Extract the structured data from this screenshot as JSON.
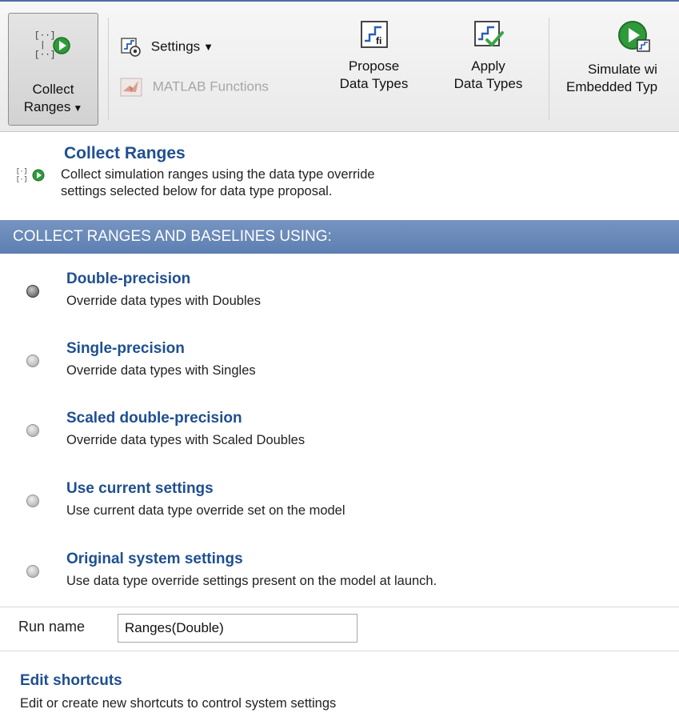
{
  "toolstrip": {
    "collect_ranges": {
      "label_line1": "Collect",
      "label_line2": "Ranges",
      "caret": "▼",
      "icon": "collect-ranges-icon"
    },
    "settings": {
      "label": "Settings",
      "caret": "▼",
      "icon": "settings-icon"
    },
    "matlab_functions": {
      "label": "MATLAB Functions",
      "icon": "matlab-logo-icon"
    },
    "propose": {
      "label_line1": "Propose",
      "label_line2": "Data Types",
      "icon": "propose-fi-icon"
    },
    "apply": {
      "label_line1": "Apply",
      "label_line2": "Data Types",
      "icon": "apply-check-icon"
    },
    "simulate": {
      "label_line1": "Simulate wi",
      "label_line2": "Embedded Typ",
      "icon": "simulate-play-icon"
    }
  },
  "header": {
    "title": "Collect Ranges",
    "description_line1": "Collect simulation ranges using the data type override",
    "description_line2": "settings selected below for data type proposal."
  },
  "group": {
    "title": "COLLECT RANGES AND BASELINES USING:"
  },
  "options": [
    {
      "title": "Double-precision",
      "description": "Override data types with Doubles",
      "selected": true
    },
    {
      "title": "Single-precision",
      "description": "Override data types with Singles",
      "selected": false
    },
    {
      "title": "Scaled double-precision",
      "description": "Override data types with Scaled Doubles",
      "selected": false
    },
    {
      "title": "Use current settings",
      "description": "Use current data type override set on the model",
      "selected": false
    },
    {
      "title": "Original system settings",
      "description": "Use data type override settings present on the model at launch.",
      "selected": false
    }
  ],
  "run_name": {
    "label": "Run name",
    "value": "Ranges(Double)"
  },
  "shortcuts": {
    "title": "Edit shortcuts",
    "description": "Edit or create new shortcuts to control system settings"
  },
  "colors": {
    "accent": "#1f4f90",
    "banner": "#6a8abb",
    "play_green": "#2e9a3a"
  }
}
